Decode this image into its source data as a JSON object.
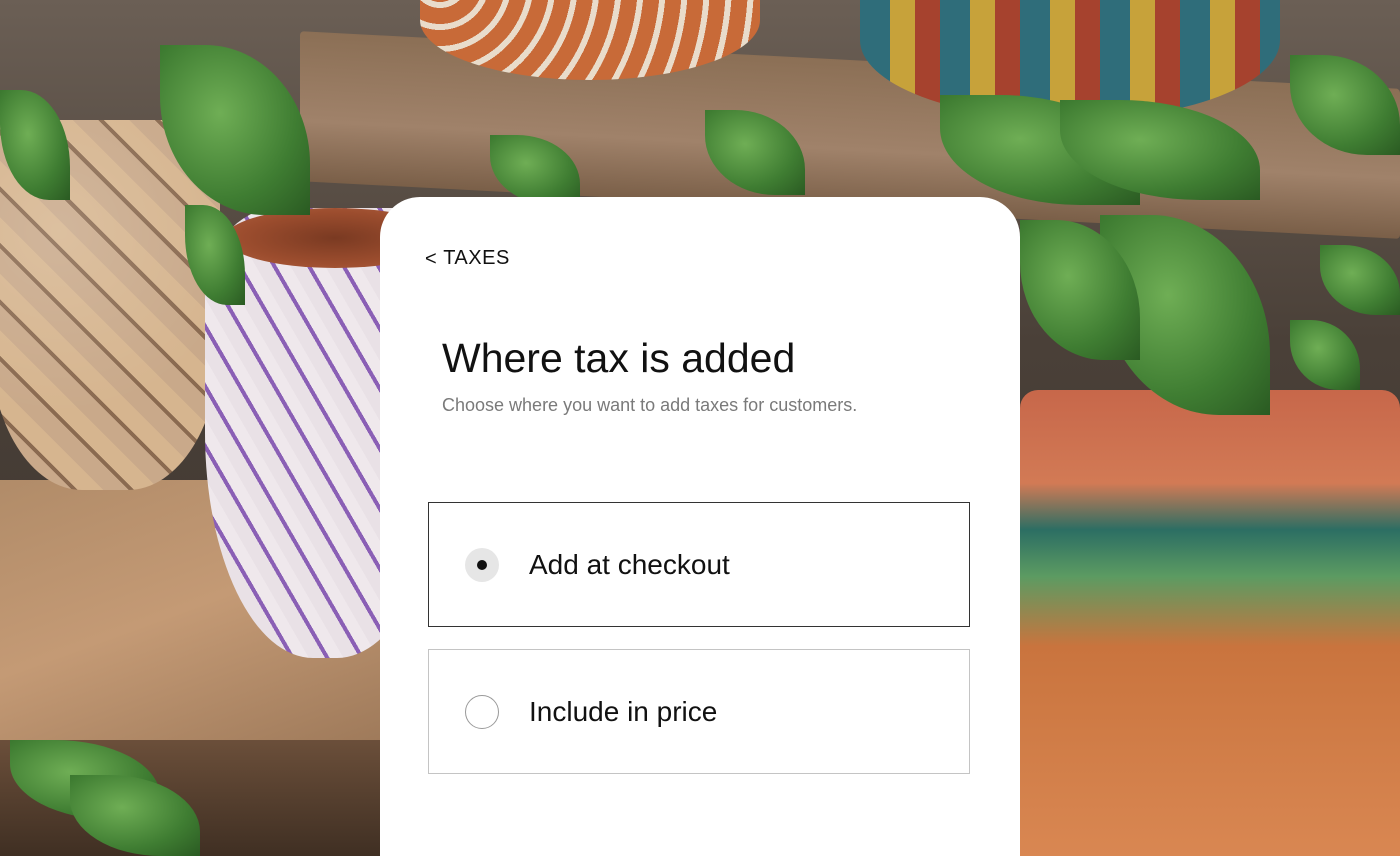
{
  "header": {
    "back_chevron": "<",
    "back_label": "TAXES"
  },
  "main": {
    "title": "Where tax is added",
    "subtitle": "Choose where you want to add taxes for customers.",
    "options": [
      {
        "label": "Add at checkout",
        "selected": true
      },
      {
        "label": "Include in price",
        "selected": false
      }
    ]
  },
  "colors": {
    "card_background": "#ffffff",
    "text_primary": "#111111",
    "text_secondary": "#7a7a7a",
    "selected_border": "#333333",
    "unselected_border": "#c4c4c4"
  }
}
